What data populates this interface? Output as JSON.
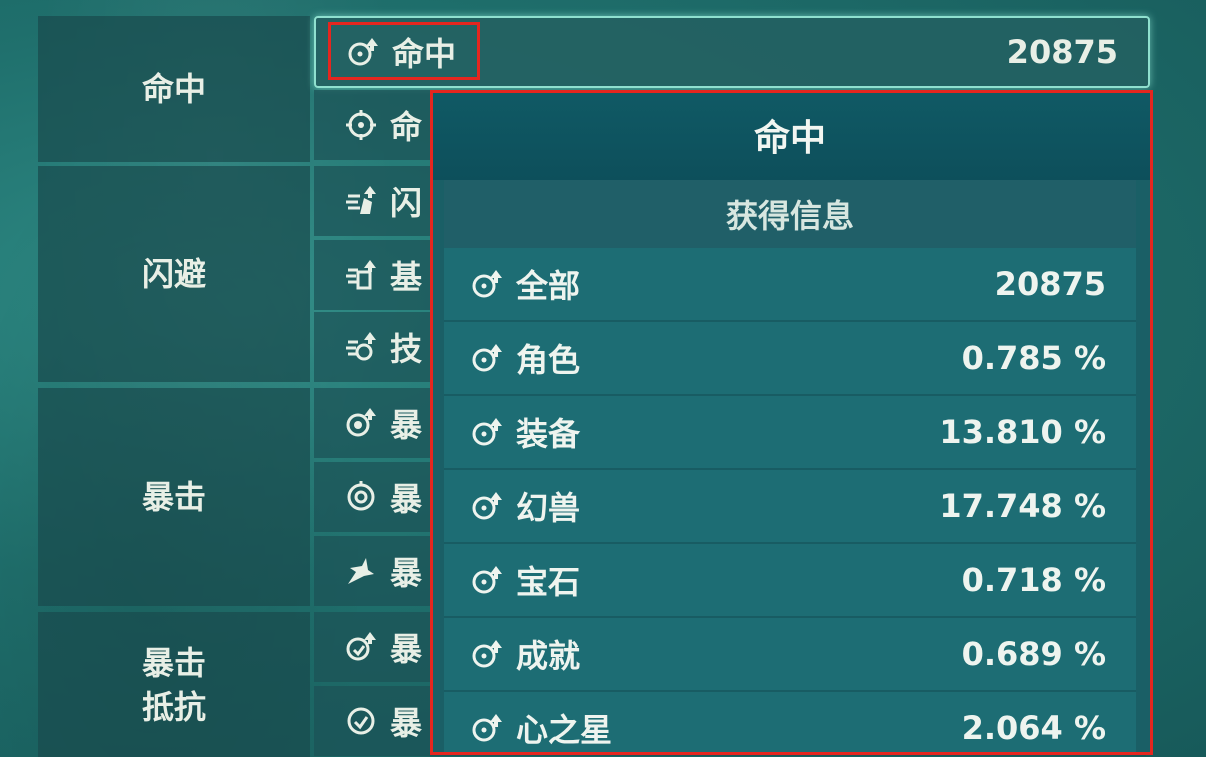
{
  "categories": [
    {
      "label": "命中"
    },
    {
      "label": "闪避"
    },
    {
      "label": "暴击"
    },
    {
      "label": "暴击\n抵抗"
    }
  ],
  "stat_rows": [
    {
      "icon": "hit-up-icon",
      "label": "命中",
      "value": "20875"
    },
    {
      "icon": "crosshair-icon",
      "label": "命",
      "value": ""
    },
    {
      "icon": "dodge-up-icon",
      "label": "闪",
      "value": ""
    },
    {
      "icon": "dodge-base-icon",
      "label": "基",
      "value": ""
    },
    {
      "icon": "dodge-skill-icon",
      "label": "技",
      "value": ""
    },
    {
      "icon": "crit-up-icon",
      "label": "暴",
      "value": ""
    },
    {
      "icon": "crit-target-icon",
      "label": "暴",
      "value": ""
    },
    {
      "icon": "crit-burst-icon",
      "label": "暴",
      "value": ""
    },
    {
      "icon": "crit-resist-up-icon",
      "label": "暴",
      "value": ""
    },
    {
      "icon": "crit-resist-icon",
      "label": "暴",
      "value": ""
    }
  ],
  "popup": {
    "title": "命中",
    "subtitle": "获得信息",
    "rows": [
      {
        "label": "全部",
        "value": "20875"
      },
      {
        "label": "角色",
        "value": "0.785 %"
      },
      {
        "label": "装备",
        "value": "13.810 %"
      },
      {
        "label": "幻兽",
        "value": "17.748 %"
      },
      {
        "label": "宝石",
        "value": "0.718 %"
      },
      {
        "label": "成就",
        "value": "0.689 %"
      },
      {
        "label": "心之星",
        "value": "2.064 %"
      }
    ]
  },
  "colors": {
    "highlight": "#e5261f",
    "selected_border": "#8fe0cf"
  }
}
